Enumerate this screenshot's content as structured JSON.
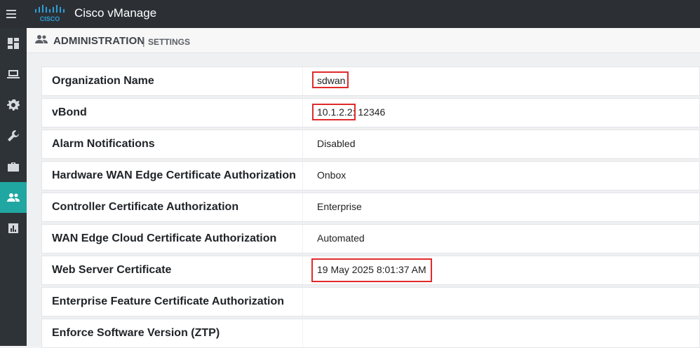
{
  "app": {
    "title": "Cisco vManage",
    "logo_text": "CISCO"
  },
  "header": {
    "title": "ADMINISTRATION",
    "separator": "|",
    "subtitle": "SETTINGS",
    "icon": "users-icon"
  },
  "sidebar": {
    "items": [
      {
        "icon": "dashboard-icon",
        "active": false
      },
      {
        "icon": "monitor-icon",
        "active": false
      },
      {
        "icon": "gear-icon",
        "active": false
      },
      {
        "icon": "wrench-icon",
        "active": false
      },
      {
        "icon": "briefcase-icon",
        "active": false
      },
      {
        "icon": "users-icon",
        "active": true
      },
      {
        "icon": "chart-icon",
        "active": false
      }
    ]
  },
  "settings": [
    {
      "label": "Organization Name",
      "value": "sdwan"
    },
    {
      "label": "vBond",
      "value_ip": "10.1.2.2",
      "value_port": ": 12346"
    },
    {
      "label": "Alarm Notifications",
      "value": "Disabled"
    },
    {
      "label": "Hardware WAN Edge Certificate Authorization",
      "value": "Onbox"
    },
    {
      "label": "Controller Certificate Authorization",
      "value": "Enterprise"
    },
    {
      "label": "WAN Edge Cloud Certificate Authorization",
      "value": "Automated"
    },
    {
      "label": "Web Server Certificate",
      "value": "19 May 2025 8:01:37 AM"
    },
    {
      "label": "Enterprise Feature Certificate Authorization",
      "value": ""
    },
    {
      "label": "Enforce Software Version (ZTP)",
      "value": ""
    }
  ],
  "colors": {
    "accent": "#21a7a1",
    "highlight": "#e02a2a",
    "topbar": "#2c3035"
  }
}
